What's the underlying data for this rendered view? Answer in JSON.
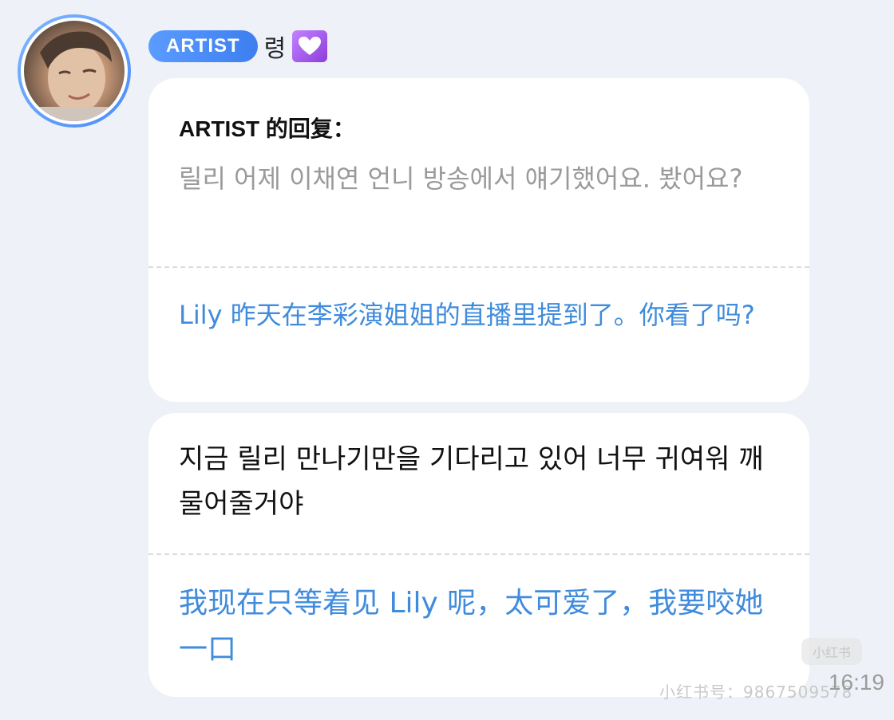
{
  "header": {
    "badge": "ARTIST",
    "name": "령",
    "emoji_icon": "purple-heart-icon"
  },
  "reply_card": {
    "label": "ARTIST 的回复：",
    "quote_text": "릴리 어제 이채연 언니 방송에서 얘기했어요. 봤어요?",
    "translation": "Lily 昨天在李彩演姐姐的直播里提到了。你看了吗?"
  },
  "message_card": {
    "text": "지금 릴리 만나기만을 기다리고 있어 너무 귀여워 깨물어줄거야",
    "translation": "我现在只等着见 Lily 呢，太可爱了，我要咬她一口"
  },
  "watermark": {
    "logo_text": "小红书",
    "id_text": "小红书号：9867509578"
  },
  "timestamp": "16:19",
  "colors": {
    "background": "#eef1f7",
    "badge": "#4a8ef5",
    "translation": "#3f8bdc",
    "quote": "#9a9a9a"
  }
}
